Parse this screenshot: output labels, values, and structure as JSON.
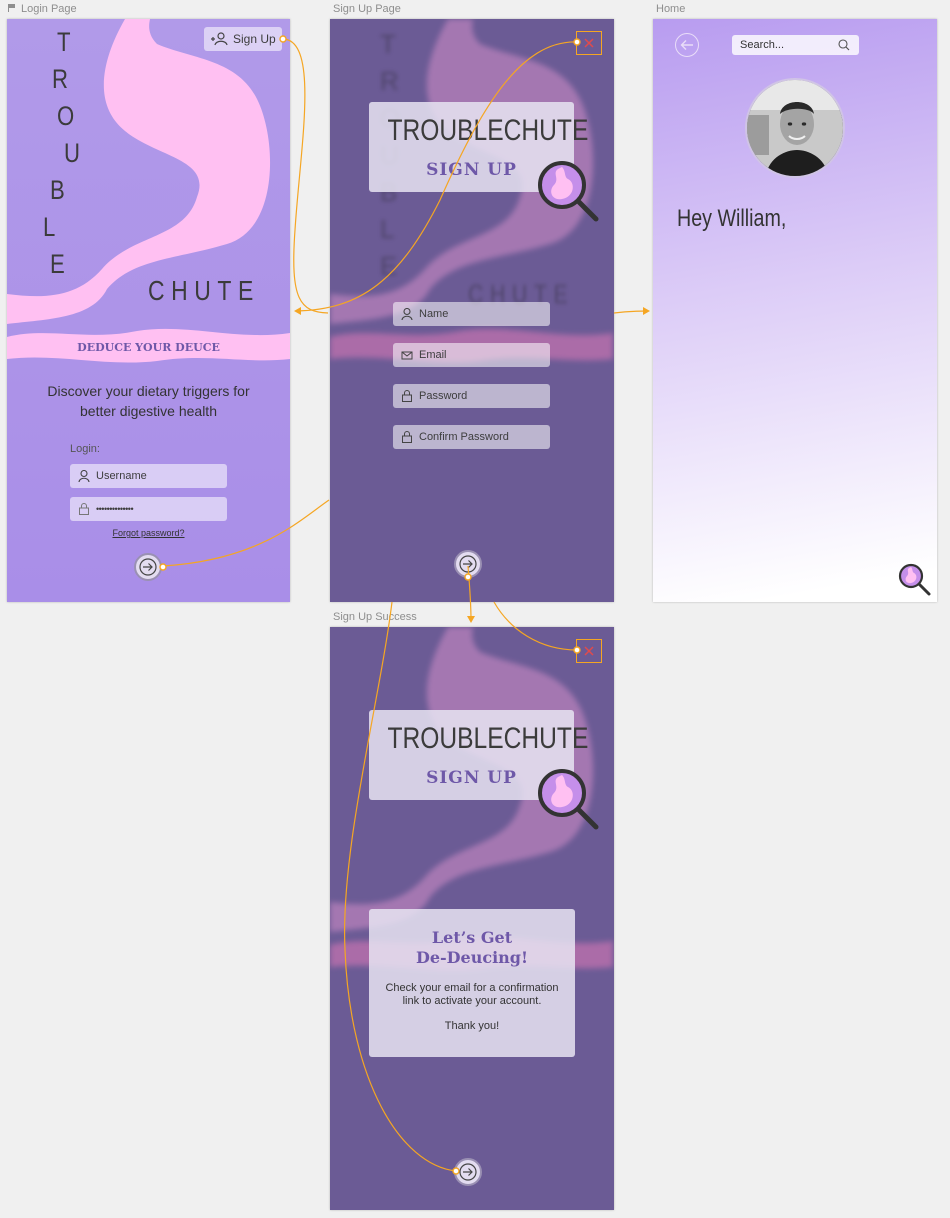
{
  "artboard_labels": {
    "login": "Login Page",
    "signup": "Sign Up Page",
    "home": "Home",
    "success": "Sign Up Success"
  },
  "login": {
    "title_letters": [
      "T",
      "R",
      "O",
      "U",
      "B",
      "L",
      "E"
    ],
    "title_chute": "CHUTE",
    "signup_button": "Sign Up",
    "tagline": "DEDUCE YOUR DEUCE",
    "description_line1": "Discover your dietary triggers for",
    "description_line2": "better digestive health",
    "login_label": "Login:",
    "username_placeholder": "Username",
    "password_value": "••••••••••••••",
    "forgot_link": "Forgot password?"
  },
  "signup": {
    "logo": "TROUBLECHUTE",
    "subtitle": "SIGN UP",
    "fields": [
      "Name",
      "Email",
      "Password",
      "Confirm Password"
    ],
    "bg_letters_left": [
      "T",
      "R",
      "O",
      "U",
      "B",
      "L",
      "E"
    ],
    "bg_chute": "CHUTE"
  },
  "home": {
    "search_placeholder": "Search...",
    "greeting": "Hey William,"
  },
  "success": {
    "logo": "TROUBLECHUTE",
    "subtitle": "SIGN UP",
    "heading_line1": "Let’s Get",
    "heading_line2": "De-Deucing!",
    "message_line1": "Check your email for a confirmation",
    "message_line2": "link to activate your account.",
    "thanks": "Thank you!"
  },
  "colors": {
    "accent_orange": "#f5a623",
    "purple_text": "#6e58a8",
    "pink_blob": "#ffc0f2",
    "close_red": "#e14b4b"
  }
}
